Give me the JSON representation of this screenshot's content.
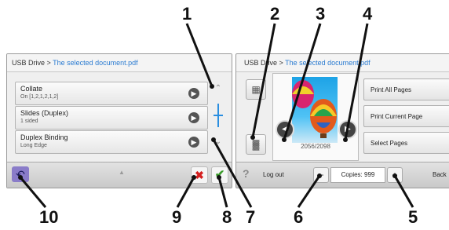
{
  "callouts": [
    "1",
    "2",
    "3",
    "4",
    "5",
    "6",
    "7",
    "8",
    "9",
    "10"
  ],
  "left_panel": {
    "breadcrumb": {
      "prefix": "USB Drive > ",
      "link": "The selected document.pdf"
    },
    "items": [
      {
        "title": "Collate",
        "subtitle": "On [1,2,1,2,1,2]"
      },
      {
        "title": "Slides (Duplex)",
        "subtitle": "1 sided"
      },
      {
        "title": "Duplex Binding",
        "subtitle": "Long Edge"
      }
    ],
    "icons": {
      "back": "back-arrow-icon",
      "cancel": "cancel-x-icon",
      "ok": "checkmark-icon",
      "go": "arrow-right-icon"
    }
  },
  "right_panel": {
    "breadcrumb": {
      "prefix": "USB Drive > ",
      "link": "The selected document.pdf"
    },
    "page_counter": "2056/2098",
    "buttons": [
      "Print All Pages",
      "Print Current Page",
      "Select Pages"
    ],
    "bottom_bar": {
      "help": "?",
      "logout": "Log out",
      "minus": "−",
      "copies": "Copies: 999",
      "plus": "+",
      "back": "Back"
    }
  },
  "colors": {
    "accent": "#2a7bd1",
    "cancel": "#d41f1f",
    "ok": "#3a9b2a",
    "back_button": "#8a7cc9"
  }
}
